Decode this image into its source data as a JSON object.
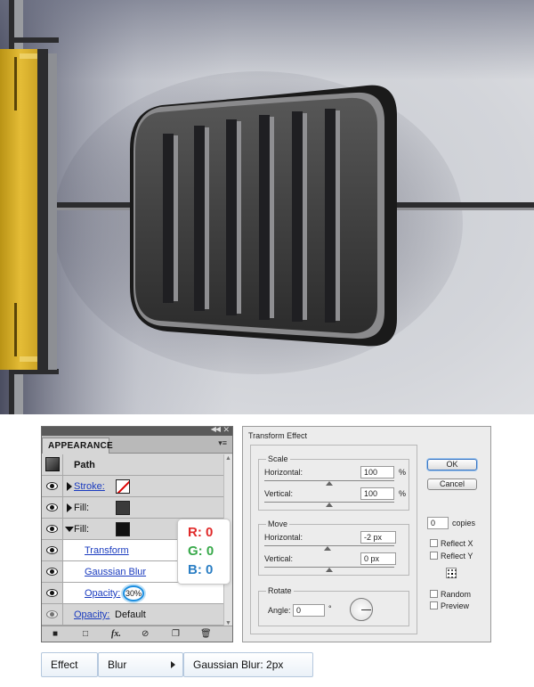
{
  "appearance": {
    "tab_label": "APPEARANCE",
    "object_type": "Path",
    "rows": [
      {
        "label": "Stroke:",
        "link": true
      },
      {
        "label": "Fill:",
        "link": false,
        "swatch": "#3a3a3a"
      },
      {
        "label": "Fill:",
        "link": false,
        "swatch": "#111111"
      },
      {
        "label": "Transform",
        "link": true
      },
      {
        "label": "Gaussian Blur",
        "link": true
      },
      {
        "label": "Opacity:",
        "link": true,
        "value": "30%"
      },
      {
        "label": "Opacity:",
        "link": true,
        "value": "Default"
      }
    ]
  },
  "rgb": {
    "r": "R: 0",
    "g": "G: 0",
    "b": "B: 0",
    "r_color": "#e02a2a",
    "g_color": "#38a94a",
    "b_color": "#2a7ec4"
  },
  "transform_effect": {
    "title": "Transform Effect",
    "scale": {
      "title": "Scale",
      "horizontal_label": "Horizontal:",
      "horizontal_value": "100",
      "vertical_label": "Vertical:",
      "vertical_value": "100",
      "unit": "%"
    },
    "move": {
      "title": "Move",
      "horizontal_label": "Horizontal:",
      "horizontal_value": "-2 px",
      "vertical_label": "Vertical:",
      "vertical_value": "0 px"
    },
    "rotate": {
      "title": "Rotate",
      "angle_label": "Angle:",
      "angle_value": "0",
      "angle_unit": "°"
    },
    "buttons": {
      "ok": "OK",
      "cancel": "Cancel"
    },
    "copies_value": "0",
    "copies_label": "copies",
    "reflect_x": "Reflect X",
    "reflect_y": "Reflect Y",
    "random": "Random",
    "preview": "Preview"
  },
  "breadcrumb": {
    "effect": "Effect",
    "blur": "Blur",
    "gaussian": "Gaussian Blur: 2px"
  }
}
